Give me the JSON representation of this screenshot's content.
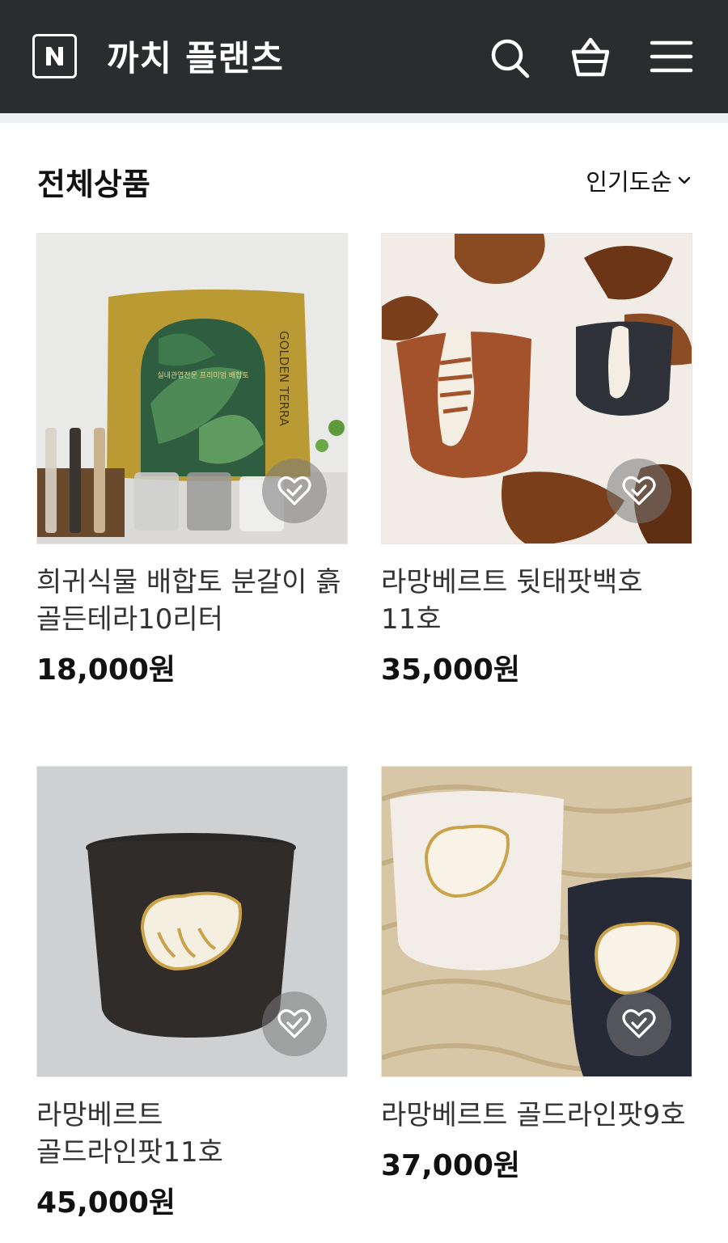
{
  "header": {
    "logo_icon": "naver-n-logo-icon",
    "title": "까치 플랜츠",
    "icons": [
      "search-icon",
      "shopping-bag-icon",
      "hamburger-menu-icon"
    ],
    "background": "#2b2c2e"
  },
  "section": {
    "title": "전체상품",
    "sort_label": "인기도순",
    "sort_icon": "chevron-down-icon"
  },
  "products": [
    {
      "name": "희귀식물 배합토 분갈이 흙 골든테라10리터",
      "price": "18,000원",
      "package_brand": "GOLDEN TERRA",
      "package_tagline": "실내관엽전문 프리미엄 배합토"
    },
    {
      "name": "라망베르트 뒷태팟백호 11호",
      "price": "35,000원"
    },
    {
      "name": "라망베르트 골드라인팟11호",
      "price": "45,000원"
    },
    {
      "name": "라망베르트 골드라인팟9호",
      "price": "37,000원"
    }
  ],
  "like_icon": "heart-check-icon"
}
